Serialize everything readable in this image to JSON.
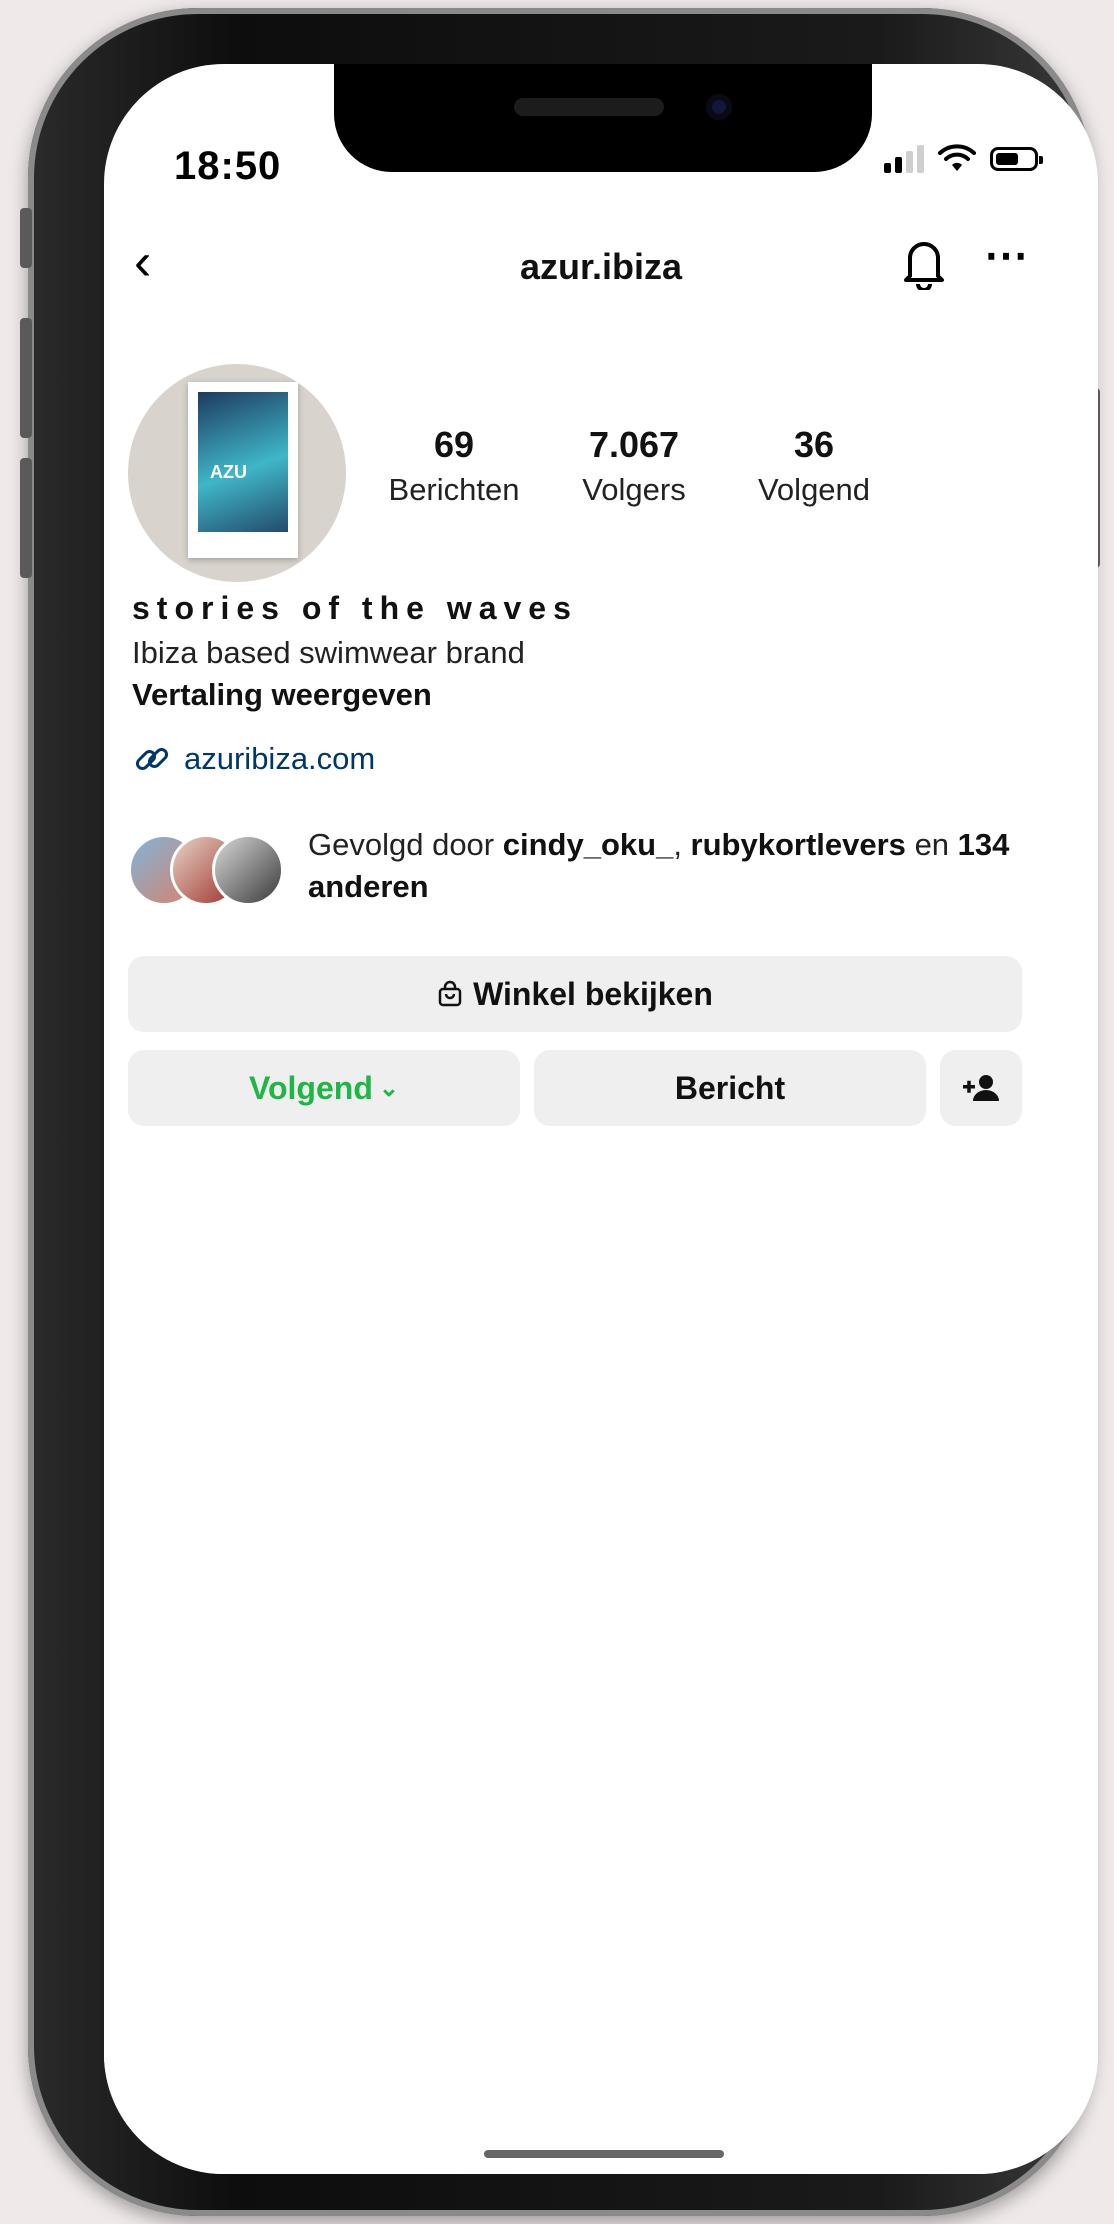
{
  "status_bar": {
    "time": "18:50"
  },
  "nav": {
    "username": "azur.ibiza"
  },
  "stats": [
    {
      "value": "69",
      "label": "Berichten"
    },
    {
      "value": "7.067",
      "label": "Volgers"
    },
    {
      "value": "36",
      "label": "Volgend"
    }
  ],
  "bio": {
    "title": "stories of the waves",
    "text": "Ibiza based swimwear brand",
    "translate": "Vertaling weergeven",
    "link": "azuribiza.com"
  },
  "followed_by": {
    "prefix": "Gevolgd door",
    "user1": "cindy_oku_",
    "user2": "rubykortlevers",
    "connector": "en",
    "others": "134 anderen"
  },
  "buttons": {
    "shop": "Winkel bekijken",
    "following": "Volgend",
    "message": "Bericht"
  },
  "grid": [
    {
      "colors": [
        "#7a3b2e",
        "#e25a9a",
        "#2b8fcf"
      ],
      "badge": "none"
    },
    {
      "colors": [
        "#8ec3e8",
        "#d9d9d9",
        "#ec4fa3"
      ],
      "badge": "none"
    },
    {
      "colors": [
        "#6b5a47",
        "#e0b978",
        "#ef4fa6"
      ],
      "badge": "shop"
    },
    {
      "colors": [
        "#d9d2cf",
        "#8a8a8a",
        "#9a4ad0"
      ],
      "badge": "shop"
    },
    {
      "colors": [
        "#4a4a3a",
        "#e83fb0",
        "#c94aa8"
      ],
      "badge": "none"
    },
    {
      "colors": [
        "#6a4b35",
        "#d9a88b",
        "#f56a4b"
      ],
      "badge": "none"
    },
    {
      "colors": [
        "#9aa7b3",
        "#f4f0ea",
        "#2f9e6b"
      ],
      "badge": "none"
    },
    {
      "colors": [
        "#1f6d4d",
        "#e9efe9",
        "#f0735a"
      ],
      "badge": "none"
    },
    {
      "colors": [
        "#4aa3e0",
        "#4cc0d4",
        "#2fd0c0"
      ],
      "badge": "multi"
    }
  ]
}
